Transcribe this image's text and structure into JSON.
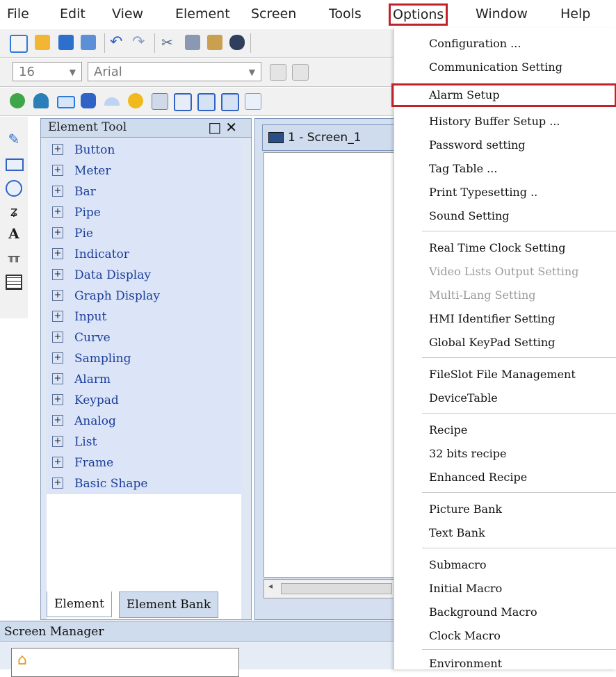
{
  "menubar": {
    "items": [
      "File",
      "Edit",
      "View",
      "Element",
      "Screen",
      "Tools",
      "Options",
      "Window",
      "Help"
    ],
    "selected": "Options"
  },
  "format_toolbar": {
    "font_size": "16",
    "font_name": "Arial"
  },
  "element_tool": {
    "title": "Element Tool",
    "items": [
      "Button",
      "Meter",
      "Bar",
      "Pipe",
      "Pie",
      "Indicator",
      "Data Display",
      "Graph Display",
      "Input",
      "Curve",
      "Sampling",
      "Alarm",
      "Keypad",
      "Analog",
      "List",
      "Frame",
      "Basic Shape"
    ],
    "tabs": [
      "Element",
      "Element Bank"
    ]
  },
  "screen": {
    "tab_label": "1 - Screen_1"
  },
  "screen_manager": {
    "title": "Screen Manager"
  },
  "options_menu": {
    "items": [
      "Configuration ...",
      "Communication Setting",
      "Alarm Setup",
      "History Buffer Setup ...",
      "Password setting",
      "Tag Table ...",
      "Print Typesetting ..",
      "Sound Setting",
      "Real Time Clock Setting",
      "Video Lists Output Setting",
      "Multi-Lang Setting",
      "HMI Identifier Setting",
      "Global KeyPad Setting",
      "FileSlot File Management",
      "DeviceTable",
      "Recipe",
      "32 bits recipe",
      "Enhanced Recipe",
      "Picture Bank",
      "Text Bank",
      "Submacro",
      "Initial Macro",
      "Background Macro",
      "Clock Macro",
      "Environment"
    ],
    "highlighted": "Alarm Setup",
    "disabled": [
      "Video Lists Output Setting",
      "Multi-Lang Setting"
    ]
  },
  "colors": {
    "highlight_border": "#c0222a",
    "tree_text": "#1c3d9a",
    "panel_bg": "#dfe7f3"
  }
}
